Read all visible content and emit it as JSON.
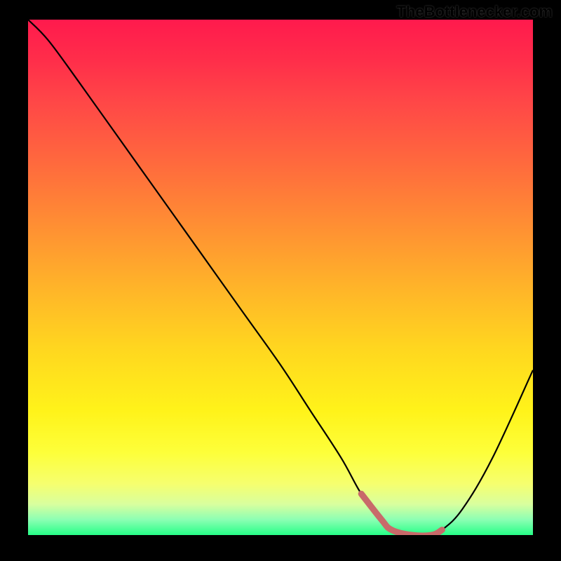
{
  "attribution": "TheBottlenecker.com",
  "chart_data": {
    "type": "line",
    "title": "",
    "xlabel": "",
    "ylabel": "",
    "xlim": [
      0,
      100
    ],
    "ylim": [
      0,
      100
    ],
    "background": "vertical-gradient red→orange→yellow→green",
    "series": [
      {
        "name": "bottleneck-curve",
        "color": "#000000",
        "x": [
          0,
          4,
          10,
          18,
          26,
          34,
          42,
          50,
          56,
          62,
          66,
          70,
          72,
          76,
          80,
          82,
          86,
          92,
          100
        ],
        "y": [
          100,
          96,
          88,
          77,
          66,
          55,
          44,
          33,
          24,
          15,
          8,
          3,
          1,
          0,
          0,
          1,
          5,
          15,
          32
        ]
      },
      {
        "name": "highlight-segment",
        "color": "#d06868",
        "stroke_width": 6,
        "x": [
          66,
          70,
          72,
          76,
          80,
          82
        ],
        "y": [
          8,
          3,
          1,
          0,
          0,
          1
        ]
      }
    ]
  }
}
